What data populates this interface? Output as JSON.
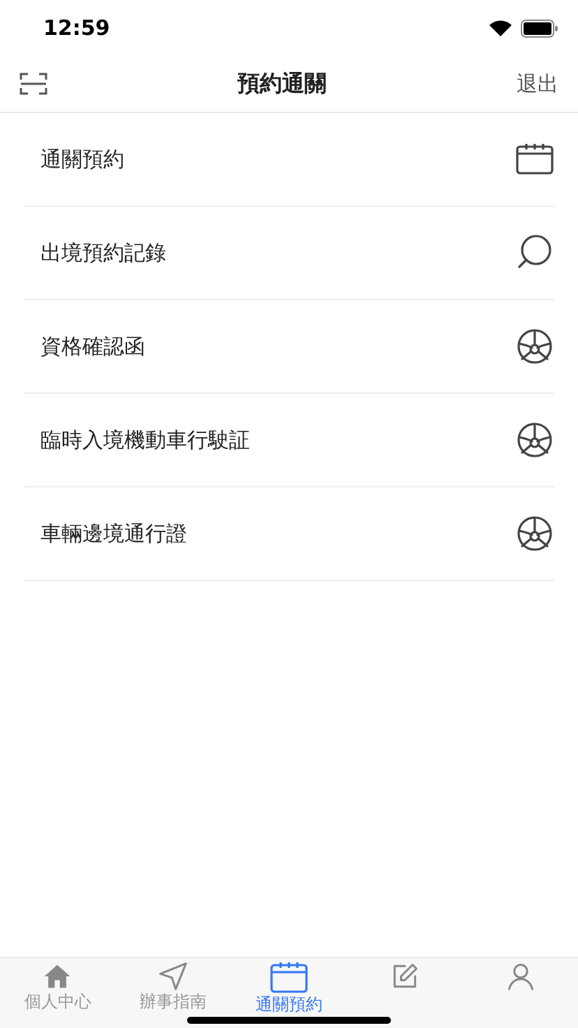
{
  "status_bar": {
    "time": "12:59"
  },
  "nav_bar": {
    "title": "預約通關",
    "action": "退出"
  },
  "menu": [
    {
      "label": "通關預約",
      "kind": "calendar"
    },
    {
      "label": "出境預約記錄",
      "kind": "search"
    },
    {
      "label": "資格確認函",
      "kind": "wheel"
    },
    {
      "label": "臨時入境機動車行駛証",
      "kind": "wheel"
    },
    {
      "label": "車輛邊境通行證",
      "kind": "wheel"
    }
  ],
  "tab_bar": [
    {
      "label": "個人中心",
      "kind": "home",
      "selected": false
    },
    {
      "label": "辦事指南",
      "kind": "send",
      "selected": false
    },
    {
      "label": "通關預約",
      "kind": "calendar",
      "selected": true
    },
    {
      "kind": "edit",
      "selected": false
    },
    {
      "kind": "person",
      "selected": false
    }
  ]
}
